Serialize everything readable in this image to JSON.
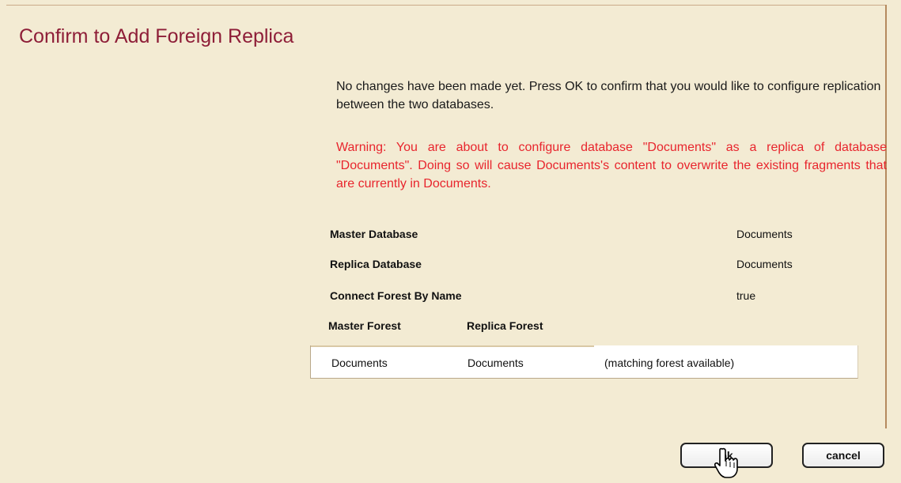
{
  "dialog": {
    "title": "Confirm to Add Foreign Replica",
    "intro": "No changes have been made yet. Press OK to confirm that you would like to configure replication between the two databases.",
    "warning": "Warning: You are about to configure database \"Documents\" as a replica of database \"Documents\". Doing so will cause Documents's content to overwrite the existing fragments that are currently in Documents."
  },
  "summary": {
    "master_database": {
      "label": "Master Database",
      "value": "Documents"
    },
    "replica_database": {
      "label": "Replica Database",
      "value": "Documents"
    },
    "connect_forest_by_name": {
      "label": "Connect Forest By Name",
      "value": "true"
    }
  },
  "forests": {
    "headers": [
      "Master Forest",
      "Replica Forest"
    ],
    "rows": [
      {
        "master": "Documents",
        "replica": "Documents",
        "status": "(matching forest available)"
      }
    ]
  },
  "buttons": {
    "ok": "ok",
    "cancel": "cancel"
  },
  "colors": {
    "background": "#f3ebd3",
    "title": "#8e1e38",
    "warning": "#e8252d"
  },
  "icons": {
    "cursor": "hand-pointer-icon"
  }
}
